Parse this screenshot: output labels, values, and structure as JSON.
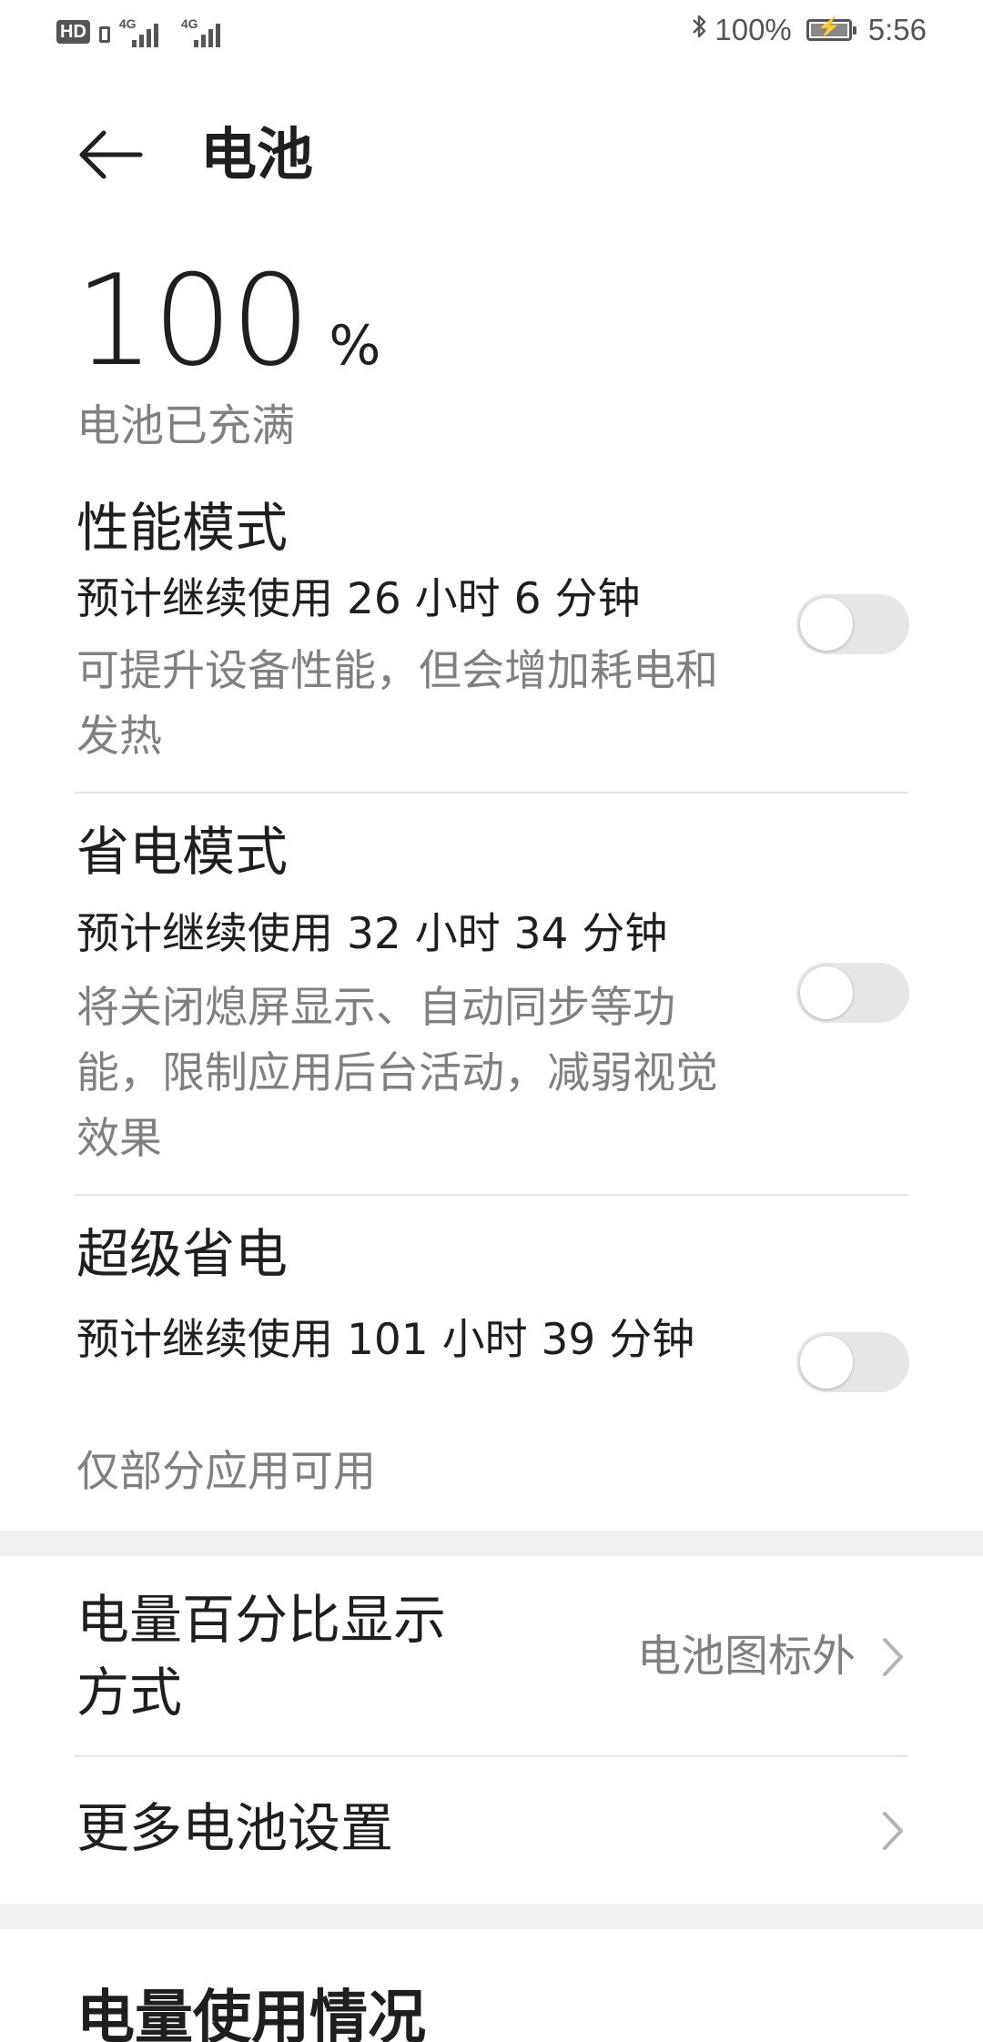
{
  "status_bar": {
    "hd_label": "HD",
    "network_1": "4G",
    "network_2": "4G",
    "battery_percent": "100%",
    "time": "5:56",
    "bluetooth_icon": "bluetooth-icon",
    "battery_icon": "battery-charging-icon",
    "battery_level": 1.0
  },
  "header": {
    "back_icon": "arrow-left-icon",
    "title": "电池"
  },
  "battery": {
    "level": "100",
    "unit": "%",
    "status": "电池已充满"
  },
  "modes": [
    {
      "title": "性能模式",
      "estimate": "预计继续使用 26 小时 6 分钟",
      "description": "可提升设备性能，但会增加耗电和发热",
      "enabled": false
    },
    {
      "title": "省电模式",
      "estimate": "预计继续使用 32 小时 34 分钟",
      "description": "将关闭熄屏显示、自动同步等功能，限制应用后台活动，减弱视觉效果",
      "enabled": false
    },
    {
      "title": "超级省电",
      "estimate": "预计继续使用 101 小时 39 分钟",
      "description": "仅部分应用可用",
      "enabled": false
    }
  ],
  "settings": {
    "percent_display": {
      "label": "电量百分比显示方式",
      "value": "电池图标外"
    },
    "more_settings": {
      "label": "更多电池设置"
    }
  },
  "usage": {
    "title": "电量使用情况"
  },
  "colors": {
    "primary_text": "#1f1f1f",
    "secondary_text": "#808080",
    "toggle_off": "#e6e6e6",
    "divider": "#e5e5e5",
    "section_gap": "#f1f1f1"
  }
}
